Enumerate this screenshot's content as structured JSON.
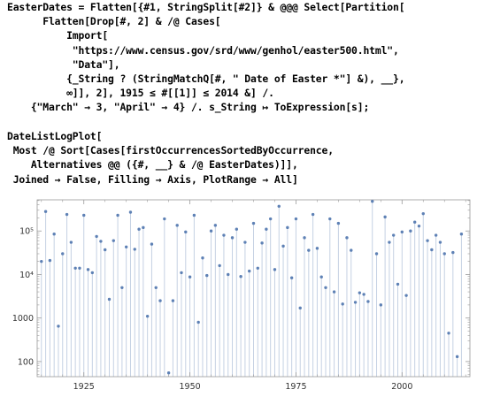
{
  "cells": [
    {
      "lines": [
        "EasterDates = Flatten[{#1, StringSplit[#2]} & @@@ Select[Partition[",
        "      Flatten[Drop[#, 2] & /@ Cases[",
        "          Import[",
        "           \"https://www.census.gov/srd/www/genhol/easter500.html\",",
        "           \"Data\"],",
        "          {_String ? (StringMatchQ[#, \" Date of Easter *\"] &), __},",
        "          ∞]], 2], 1915 ≤ #[[1]] ≤ 2014 &] /.",
        "    {\"March\" → 3, \"April\" → 4} /. s_String ↦ ToExpression[s];"
      ]
    },
    {
      "lines": [
        "DateListLogPlot[",
        " Most /@ Sort[Cases[firstOccurrencesSortedByOccurrence,",
        "    Alternatives @@ ({#, __} & /@ EasterDates)]],",
        " Joined → False, Filling → Axis, PlotRange → All]"
      ]
    }
  ],
  "chart_data": {
    "type": "scatter",
    "title": "",
    "xlabel": "",
    "ylabel": "",
    "scale_y": "log",
    "filling": "axis",
    "joined": false,
    "xlim": [
      1914,
      2016
    ],
    "ylim": [
      45,
      520000
    ],
    "x_tick_labels": [
      "1925",
      "1950",
      "1975",
      "2000"
    ],
    "x_ticks": [
      1925,
      1950,
      1975,
      2000
    ],
    "y_tick_labels": [
      "100",
      "1000",
      "10⁴",
      "10⁵"
    ],
    "y_ticks": [
      100,
      1000,
      10000,
      100000
    ],
    "marker_color": "#5e81b5",
    "filling_color": "#c5d1e3",
    "x": [
      1915,
      1916,
      1917,
      1918,
      1919,
      1920,
      1921,
      1922,
      1923,
      1924,
      1925,
      1926,
      1927,
      1928,
      1929,
      1930,
      1931,
      1932,
      1933,
      1934,
      1935,
      1936,
      1937,
      1938,
      1939,
      1940,
      1941,
      1942,
      1943,
      1944,
      1945,
      1946,
      1947,
      1948,
      1949,
      1950,
      1951,
      1952,
      1953,
      1954,
      1955,
      1956,
      1957,
      1958,
      1959,
      1960,
      1961,
      1962,
      1963,
      1964,
      1965,
      1966,
      1967,
      1968,
      1969,
      1970,
      1971,
      1972,
      1973,
      1974,
      1975,
      1976,
      1977,
      1978,
      1979,
      1980,
      1981,
      1982,
      1983,
      1984,
      1985,
      1986,
      1987,
      1988,
      1989,
      1990,
      1991,
      1992,
      1993,
      1994,
      1995,
      1996,
      1997,
      1998,
      1999,
      2000,
      2001,
      2002,
      2003,
      2004,
      2005,
      2006,
      2007,
      2008,
      2009,
      2010,
      2011,
      2012,
      2013,
      2014
    ],
    "values": [
      20000,
      280000,
      21000,
      85000,
      650,
      30000,
      240000,
      55000,
      14000,
      14000,
      230000,
      13000,
      11000,
      75000,
      58000,
      37000,
      2700,
      60000,
      230000,
      5000,
      43000,
      270000,
      38000,
      110000,
      120000,
      1100,
      50000,
      5000,
      2500,
      190000,
      55,
      2500,
      135000,
      11000,
      95000,
      8800,
      230000,
      800,
      24000,
      9500,
      100000,
      135000,
      16000,
      80000,
      10000,
      70000,
      110000,
      9000,
      55000,
      12000,
      150000,
      14000,
      53000,
      110000,
      190000,
      13000,
      370000,
      45000,
      120000,
      8400,
      190000,
      1700,
      70000,
      36000,
      240000,
      40000,
      8800,
      5000,
      190000,
      4000,
      150000,
      2100,
      70000,
      36000,
      2300,
      3800,
      3500,
      2400,
      480000,
      30000,
      2000,
      210000,
      55000,
      80000,
      6000,
      95000,
      3300,
      100000,
      160000,
      130000,
      250000,
      60000,
      37000,
      80000,
      55000,
      30000,
      450,
      32000,
      130,
      85000
    ]
  }
}
